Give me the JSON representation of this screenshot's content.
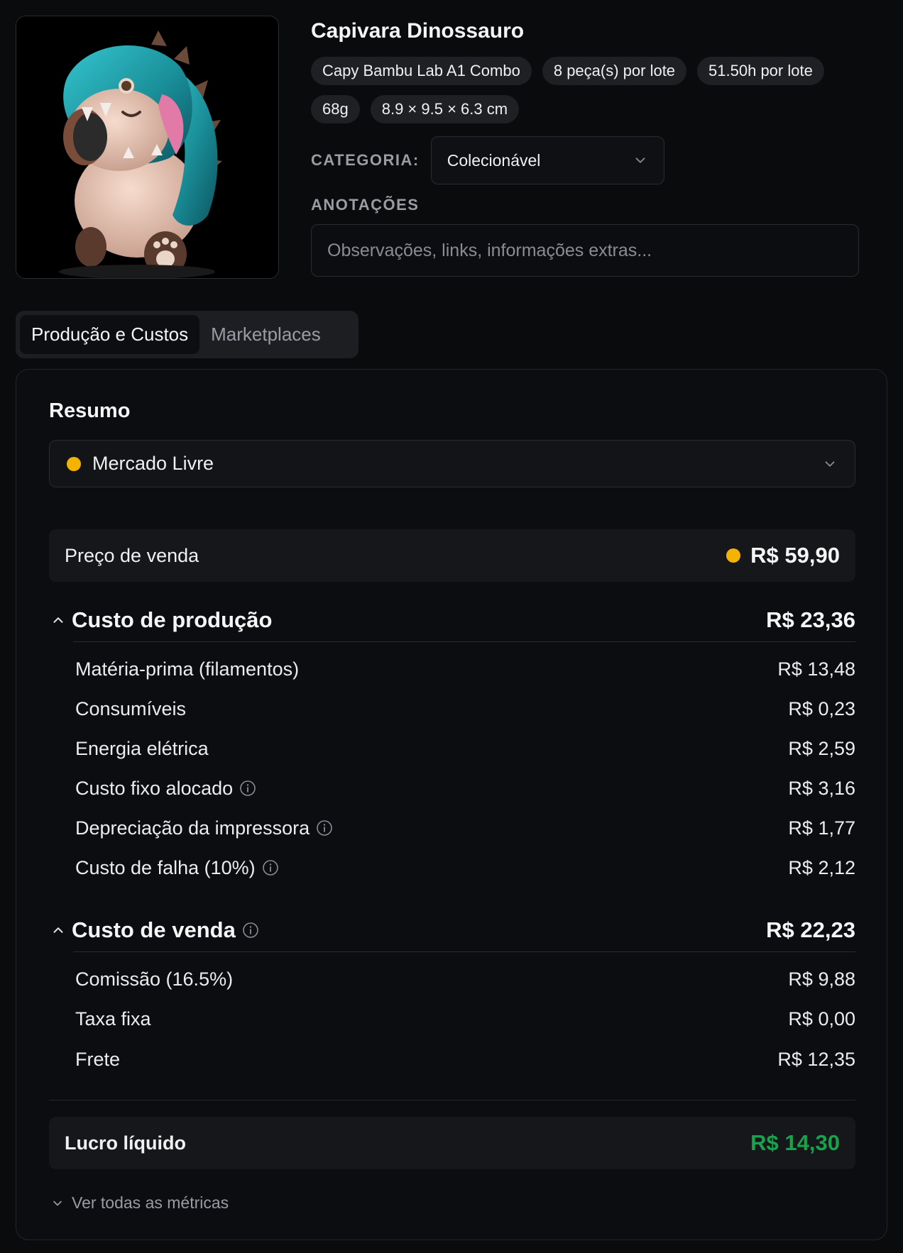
{
  "product": {
    "title": "Capivara Dinossauro",
    "chips": [
      "Capy Bambu Lab A1 Combo",
      "8 peça(s) por lote",
      "51.50h por lote",
      "68g",
      "8.9 × 9.5 × 6.3 cm"
    ],
    "category_label": "CATEGORIA:",
    "category_value": "Colecionável",
    "notes_label": "ANOTAÇÕES",
    "notes_placeholder": "Observações, links, informações extras..."
  },
  "tabs": [
    {
      "label": "Produção e Custos",
      "active": true
    },
    {
      "label": "Marketplaces",
      "active": false
    }
  ],
  "summary": {
    "title": "Resumo",
    "marketplace": "Mercado Livre",
    "marketplace_color": "#f5b301",
    "sale_price_label": "Preço de venda",
    "sale_price": "R$ 59,90",
    "production": {
      "title": "Custo de produção",
      "total": "R$ 23,36",
      "items": [
        {
          "label": "Matéria-prima (filamentos)",
          "value": "R$ 13,48",
          "info": false
        },
        {
          "label": "Consumíveis",
          "value": "R$ 0,23",
          "info": false
        },
        {
          "label": "Energia elétrica",
          "value": "R$ 2,59",
          "info": false
        },
        {
          "label": "Custo fixo alocado",
          "value": "R$ 3,16",
          "info": true
        },
        {
          "label": "Depreciação da impressora",
          "value": "R$ 1,77",
          "info": true
        },
        {
          "label": "Custo de falha (10%)",
          "value": "R$ 2,12",
          "info": true
        }
      ]
    },
    "sale_cost": {
      "title": "Custo de venda",
      "total": "R$ 22,23",
      "items": [
        {
          "label": "Comissão (16.5%)",
          "value": "R$ 9,88"
        },
        {
          "label": "Taxa fixa",
          "value": "R$ 0,00"
        },
        {
          "label": "Frete",
          "value": "R$ 12,35"
        }
      ]
    },
    "net_profit_label": "Lucro líquido",
    "net_profit": "R$ 14,30",
    "net_profit_color": "#16a34a",
    "more_metrics": "Ver todas as métricas"
  }
}
